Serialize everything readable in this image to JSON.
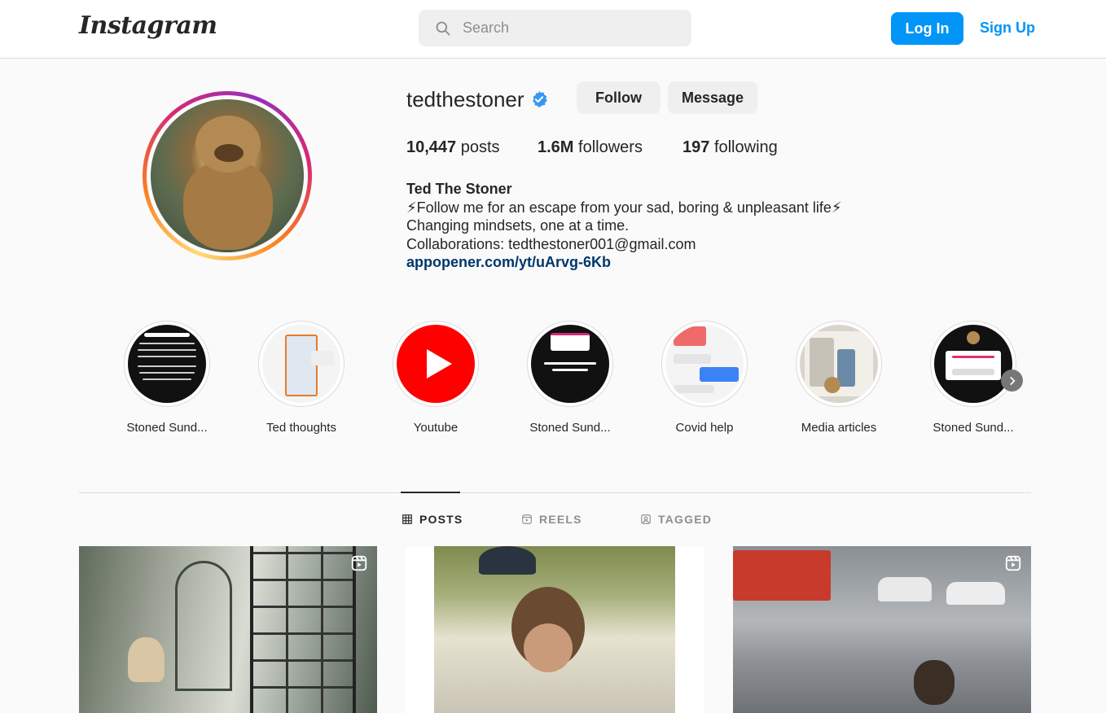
{
  "nav": {
    "logo": "Instagram",
    "search_placeholder": "Search",
    "login_label": "Log In",
    "signup_label": "Sign Up"
  },
  "profile": {
    "username": "tedthestoner",
    "verified": true,
    "follow_label": "Follow",
    "message_label": "Message",
    "stats": {
      "posts_count": "10,447",
      "posts_label": "posts",
      "followers_count": "1.6M",
      "followers_label": "followers",
      "following_count": "197",
      "following_label": "following"
    },
    "full_name": "Ted The Stoner",
    "bio_lines": [
      "⚡Follow me for an escape from your sad, boring & unpleasant life⚡",
      "Changing mindsets, one at a time.",
      "Collaborations: tedthestoner001@gmail.com"
    ],
    "link": "appopener.com/yt/uArvg-6Kb"
  },
  "highlights": [
    {
      "label": "Stoned Sund...",
      "style": "dark"
    },
    {
      "label": "Ted thoughts",
      "style": "light"
    },
    {
      "label": "Youtube",
      "style": "youtube"
    },
    {
      "label": "Stoned Sund...",
      "style": "dark"
    },
    {
      "label": "Covid help",
      "style": "light"
    },
    {
      "label": "Media articles",
      "style": "news"
    },
    {
      "label": "Stoned Sund...",
      "style": "dark"
    }
  ],
  "tabs": [
    {
      "label": "POSTS",
      "icon": "grid-icon",
      "active": true
    },
    {
      "label": "REELS",
      "icon": "reels-icon",
      "active": false
    },
    {
      "label": "TAGGED",
      "icon": "tagged-icon",
      "active": false
    }
  ],
  "posts": [
    {
      "type": "reel"
    },
    {
      "type": "post"
    },
    {
      "type": "reel"
    }
  ],
  "colors": {
    "accent": "#0095f6",
    "link": "#00376b",
    "verified": "#3897f0",
    "youtube": "#ff0000"
  }
}
